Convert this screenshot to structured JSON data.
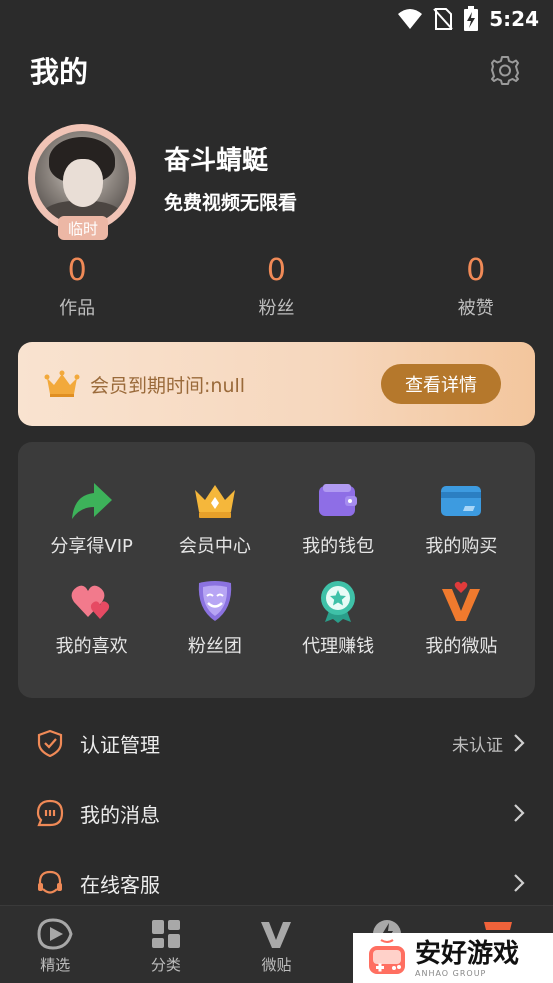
{
  "status_bar": {
    "time": "5:24"
  },
  "header": {
    "title": "我的"
  },
  "profile": {
    "username": "奋斗蜻蜓",
    "slogan": "免费视频无限看",
    "badge": "临时"
  },
  "stats": [
    {
      "value": "0",
      "label": "作品"
    },
    {
      "value": "0",
      "label": "粉丝"
    },
    {
      "value": "0",
      "label": "被赞"
    }
  ],
  "vip": {
    "text": "会员到期时间:null",
    "button": "查看详情"
  },
  "grid": [
    {
      "label": "分享得VIP",
      "icon": "share-arrow-icon"
    },
    {
      "label": "会员中心",
      "icon": "crown-icon"
    },
    {
      "label": "我的钱包",
      "icon": "wallet-icon"
    },
    {
      "label": "我的购买",
      "icon": "card-icon"
    },
    {
      "label": "我的喜欢",
      "icon": "hearts-icon"
    },
    {
      "label": "粉丝团",
      "icon": "mask-icon"
    },
    {
      "label": "代理赚钱",
      "icon": "medal-icon"
    },
    {
      "label": "我的微贴",
      "icon": "v-heart-icon"
    }
  ],
  "menu": [
    {
      "label": "认证管理",
      "status": "未认证",
      "icon": "shield-check-icon"
    },
    {
      "label": "我的消息",
      "status": "",
      "icon": "message-icon"
    },
    {
      "label": "在线客服",
      "status": "",
      "icon": "headset-icon"
    }
  ],
  "bottom_nav": [
    {
      "label": "精选",
      "icon": "play-icon"
    },
    {
      "label": "分类",
      "icon": "grid-icon"
    },
    {
      "label": "微贴",
      "icon": "v-icon"
    },
    {
      "label": "",
      "icon": "lightning-icon"
    },
    {
      "label": "",
      "icon": "profile-icon"
    }
  ],
  "watermark": {
    "text": "安好游戏",
    "sub": "ANHAO GROUP"
  },
  "colors": {
    "accent": "#f08a57",
    "vip_button": "#b5782c",
    "background": "#2b2b2b"
  }
}
